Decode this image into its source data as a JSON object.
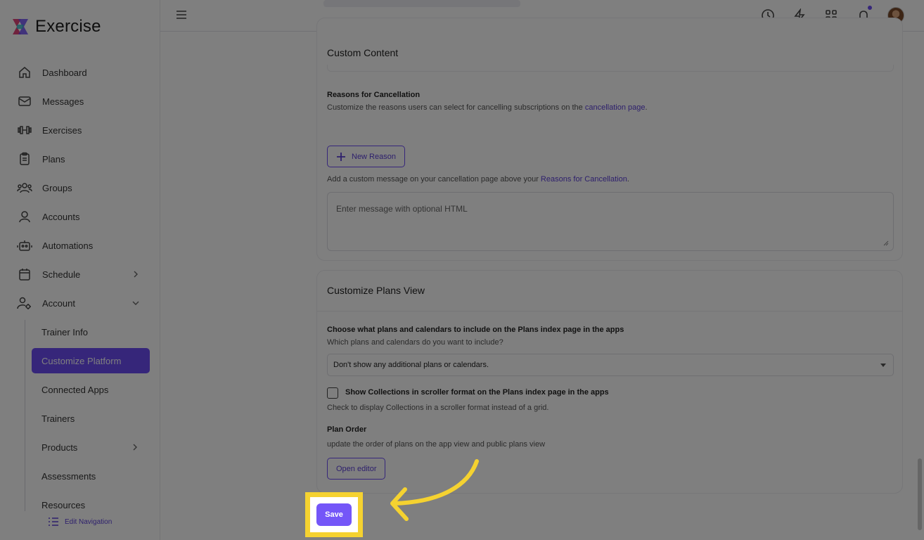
{
  "app": {
    "name": "Exercise"
  },
  "sidebar": {
    "items": [
      {
        "label": "Dashboard",
        "icon": "home-icon"
      },
      {
        "label": "Messages",
        "icon": "mail-icon"
      },
      {
        "label": "Exercises",
        "icon": "dumbbell-icon"
      },
      {
        "label": "Plans",
        "icon": "clipboard-icon"
      },
      {
        "label": "Groups",
        "icon": "users-icon"
      },
      {
        "label": "Accounts",
        "icon": "user-icon"
      },
      {
        "label": "Automations",
        "icon": "robot-icon"
      },
      {
        "label": "Schedule",
        "icon": "calendar-icon"
      },
      {
        "label": "Account",
        "icon": "user-gear-icon"
      }
    ],
    "sub_items": [
      {
        "label": "Trainer Info"
      },
      {
        "label": "Customize Platform",
        "active": true
      },
      {
        "label": "Connected Apps"
      },
      {
        "label": "Trainers"
      },
      {
        "label": "Products"
      },
      {
        "label": "Assessments"
      },
      {
        "label": "Resources"
      }
    ],
    "edit_navigation": "Edit Navigation"
  },
  "custom_content": {
    "title": "Custom Content",
    "reasons_label": "Reasons for Cancellation",
    "reasons_hint": "Customize the reasons users can select for cancelling subscriptions on the",
    "reasons_hint_link": "cancellation page",
    "reasons_hint_end": ".",
    "new_reason": "New Reason",
    "message_hint": "Add a custom message on your cancellation page above your",
    "message_hint_link": "Reasons for Cancellation",
    "message_hint_end": ".",
    "message_placeholder": "Enter message with optional HTML"
  },
  "plans_view": {
    "title": "Customize Plans View",
    "choose_label": "Choose what plans and calendars to include on the Plans index page in the apps",
    "choose_hint": "Which plans and calendars do you want to include?",
    "select_value": "Don't show any additional plans or calendars.",
    "collections_label": "Show Collections in scroller format on the Plans index page in the apps",
    "collections_checked": false,
    "collections_hint": "Check to display Collections in a scroller format instead of a grid.",
    "plan_order_label": "Plan Order",
    "plan_order_hint": "update the order of plans on the app view and public plans view",
    "open_editor": "Open editor"
  },
  "save_label": "Save",
  "colors": {
    "accent": "#6c4cf5",
    "highlight": "#f5d230"
  }
}
